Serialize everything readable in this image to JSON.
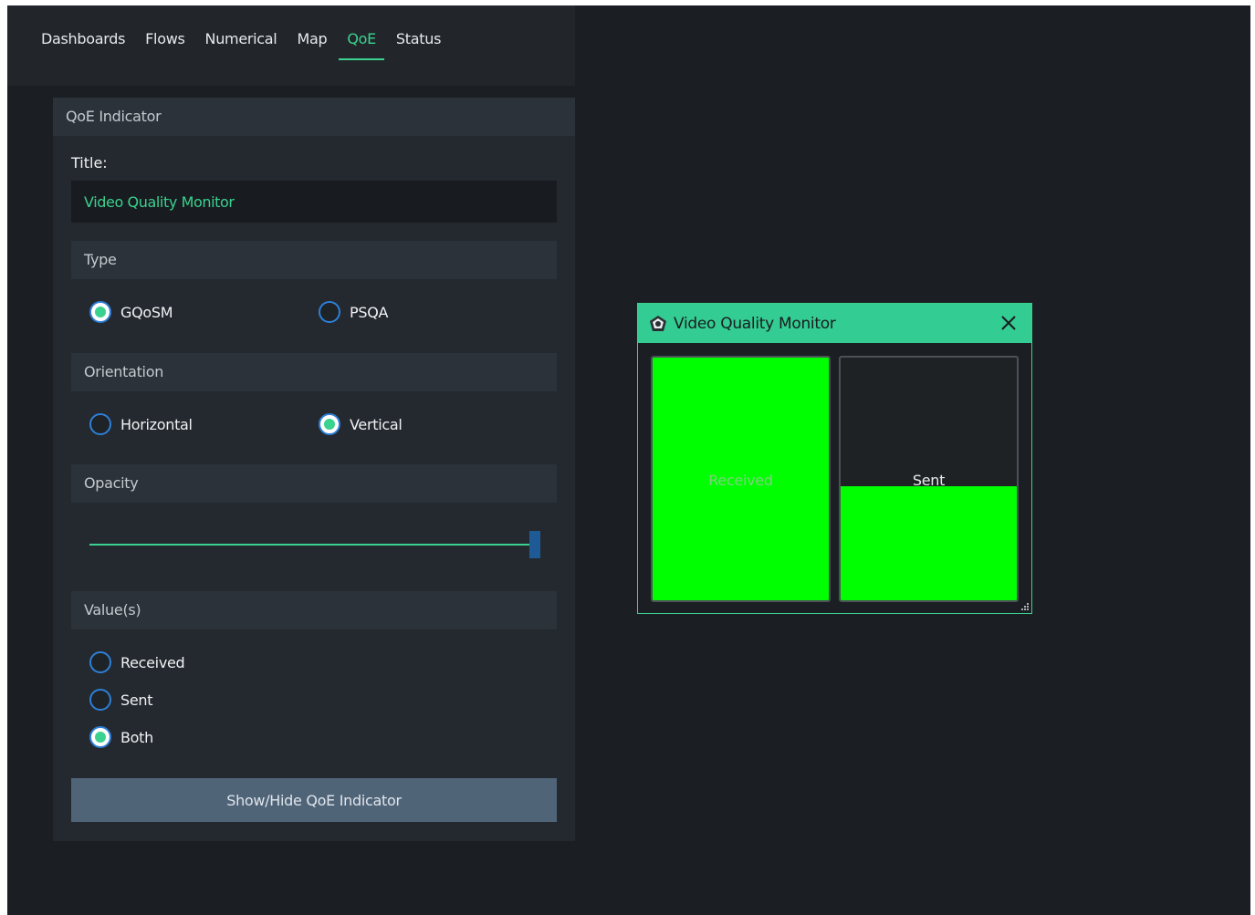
{
  "tabs": [
    {
      "label": "Dashboards"
    },
    {
      "label": "Flows"
    },
    {
      "label": "Numerical"
    },
    {
      "label": "Map"
    },
    {
      "label": "QoE"
    },
    {
      "label": "Status"
    }
  ],
  "active_tab": "QoE",
  "panel": {
    "title": "QoE Indicator",
    "title_label": "Title:",
    "title_value": "Video Quality Monitor",
    "type": {
      "header": "Type",
      "options": [
        "GQoSM",
        "PSQA"
      ],
      "selected": "GQoSM"
    },
    "orientation": {
      "header": "Orientation",
      "options": [
        "Horizontal",
        "Vertical"
      ],
      "selected": "Vertical"
    },
    "opacity": {
      "header": "Opacity",
      "value_fraction": 1.0
    },
    "values": {
      "header": "Value(s)",
      "options": [
        "Received",
        "Sent",
        "Both"
      ],
      "selected": "Both"
    },
    "button_label": "Show/Hide QoE Indicator"
  },
  "qoe_window": {
    "title": "Video Quality Monitor",
    "bars": [
      {
        "label": "Received",
        "fill_fraction": 1.0
      },
      {
        "label": "Sent",
        "fill_fraction": 0.47
      }
    ]
  },
  "colors": {
    "accent": "#3bd18f",
    "bar_fill": "#00ff00",
    "radio_border": "#2e7fd6",
    "button": "#506478"
  },
  "icons": {
    "logo": "camera-logo-icon",
    "close": "close-icon",
    "grip": "resize-grip-icon"
  }
}
